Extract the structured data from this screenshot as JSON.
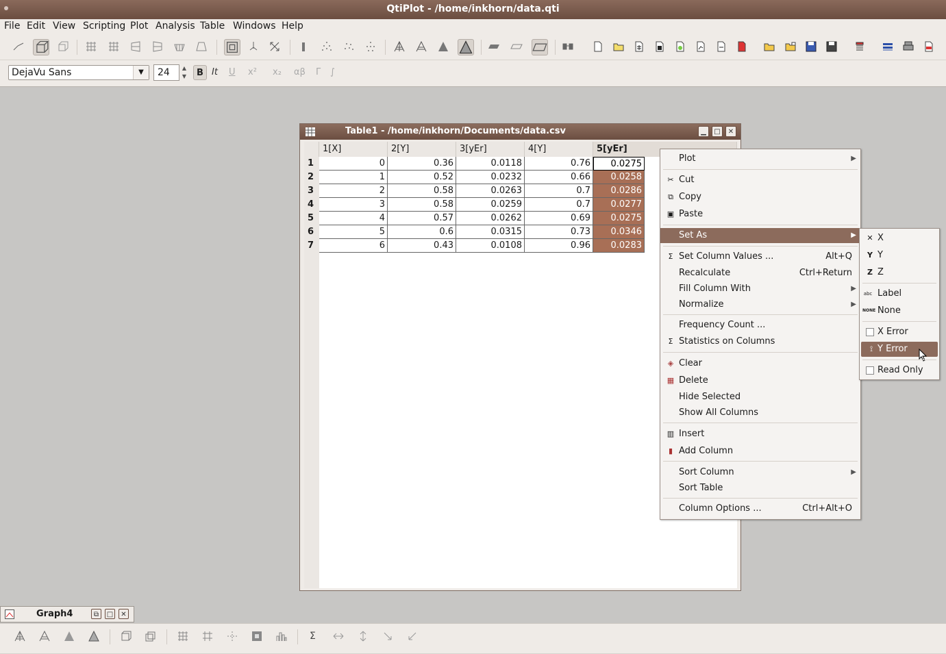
{
  "app": {
    "title": "QtiPlot - /home/inkhorn/data.qti"
  },
  "menu": [
    "File",
    "Edit",
    "View",
    "Scripting",
    "Plot",
    "Analysis",
    "Table",
    "Windows",
    "Help"
  ],
  "format_bar": {
    "font": "DejaVu Sans",
    "size": "24",
    "bold": "B",
    "italic": "It",
    "underline": "U",
    "superscript": "x²",
    "subscript": "x₂",
    "greek": "αβ",
    "gamma": "Γ",
    "integral": "∫"
  },
  "table_window": {
    "title": "Table1 - /home/inkhorn/Documents/data.csv",
    "columns": [
      "1[X]",
      "2[Y]",
      "3[yEr]",
      "4[Y]",
      "5[yEr]"
    ],
    "rows": [
      {
        "n": "1",
        "c": [
          "0",
          "0.36",
          "0.0118",
          "0.76",
          "0.0275"
        ]
      },
      {
        "n": "2",
        "c": [
          "1",
          "0.52",
          "0.0232",
          "0.66",
          "0.0258"
        ]
      },
      {
        "n": "3",
        "c": [
          "2",
          "0.58",
          "0.0263",
          "0.7",
          "0.0286"
        ]
      },
      {
        "n": "4",
        "c": [
          "3",
          "0.58",
          "0.0259",
          "0.7",
          "0.0277"
        ]
      },
      {
        "n": "5",
        "c": [
          "4",
          "0.57",
          "0.0262",
          "0.69",
          "0.0275"
        ]
      },
      {
        "n": "6",
        "c": [
          "5",
          "0.6",
          "0.0315",
          "0.73",
          "0.0346"
        ]
      },
      {
        "n": "7",
        "c": [
          "6",
          "0.43",
          "0.0108",
          "0.96",
          "0.0283"
        ]
      }
    ]
  },
  "context_menu": {
    "plot": "Plot",
    "cut": "Cut",
    "copy": "Copy",
    "paste": "Paste",
    "set_as": "Set As",
    "set_column_values": "Set Column Values ...",
    "set_column_values_sc": "Alt+Q",
    "recalculate": "Recalculate",
    "recalculate_sc": "Ctrl+Return",
    "fill_column_with": "Fill Column With",
    "normalize": "Normalize",
    "frequency_count": "Frequency Count ...",
    "statistics_on_columns": "Statistics on Columns",
    "clear": "Clear",
    "delete": "Delete",
    "hide_selected": "Hide Selected",
    "show_all_columns": "Show All Columns",
    "insert": "Insert",
    "add_column": "Add Column",
    "sort_column": "Sort Column",
    "sort_table": "Sort Table",
    "column_options": "Column Options ...",
    "column_options_sc": "Ctrl+Alt+O"
  },
  "set_as_submenu": {
    "x": "X",
    "y": "Y",
    "z": "Z",
    "label": "Label",
    "none": "None",
    "x_error": "X Error",
    "y_error": "Y Error",
    "read_only": "Read Only",
    "label_icon_text": "abc",
    "none_icon_text": "NONE"
  },
  "minimized_window": {
    "title": "Graph4"
  },
  "colors": {
    "accent": "#8c6b5c",
    "selection": "#a86f56"
  }
}
